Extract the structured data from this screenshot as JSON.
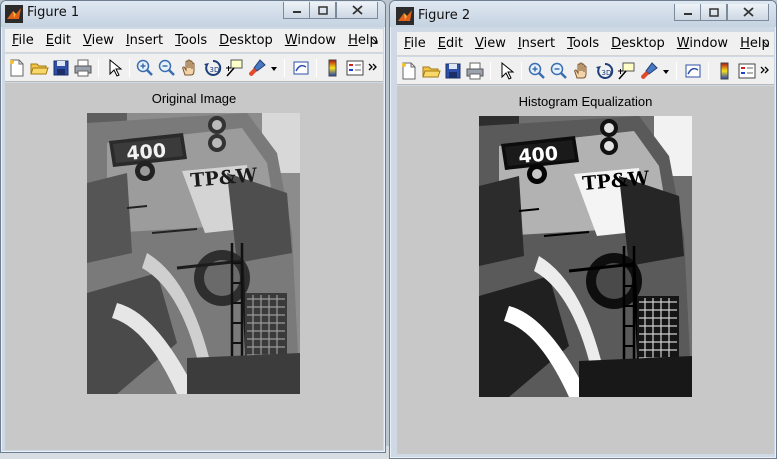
{
  "figure1": {
    "title": "Figure 1",
    "menus": [
      "File",
      "Edit",
      "View",
      "Insert",
      "Tools",
      "Desktop",
      "Window",
      "Help"
    ],
    "axes_title": "Original Image",
    "loco_number": "400",
    "loco_logo": "TP&W"
  },
  "figure2": {
    "title": "Figure 2",
    "menus": [
      "File",
      "Edit",
      "View",
      "Insert",
      "Tools",
      "Desktop",
      "Window",
      "Help"
    ],
    "axes_title": "Histogram Equalization",
    "loco_number": "400",
    "loco_logo": "TP&W"
  },
  "toolbar_icons": [
    "new-figure-icon",
    "open-file-icon",
    "save-icon",
    "print-icon",
    "edit-plot-arrow-icon",
    "zoom-in-icon",
    "zoom-out-icon",
    "pan-icon",
    "rotate-3d-icon",
    "data-cursor-icon",
    "brush-icon",
    "brush-dropdown-icon",
    "link-plot-icon",
    "colorbar-icon",
    "legend-icon",
    "toolbar-overflow-icon"
  ],
  "colors": {
    "canvas_gray": "#c8c8c8",
    "menubar": "#f0f0f0",
    "titlebar_top": "#dfe8f2",
    "matlab_icon_orange": "#e0611a"
  }
}
